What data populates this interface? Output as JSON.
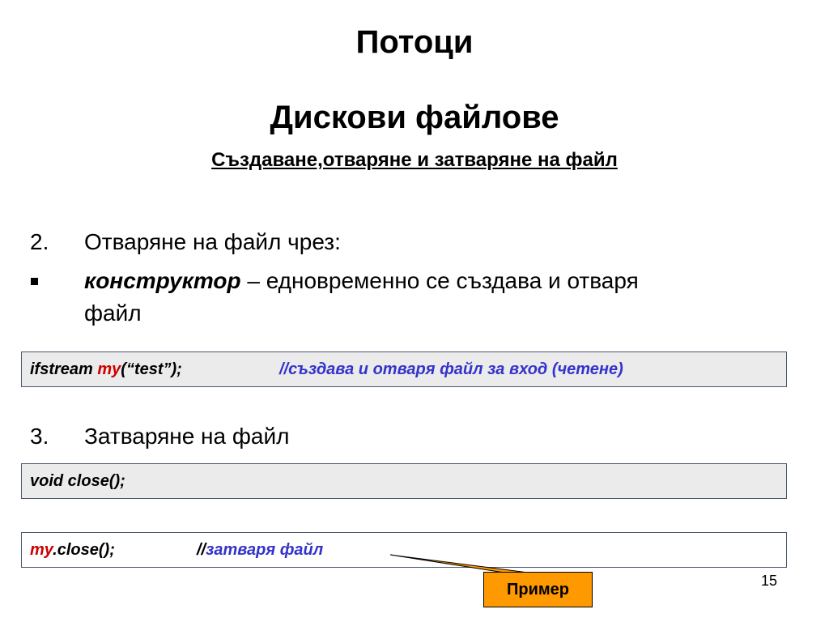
{
  "slide": {
    "title": "Потоци",
    "subtitle": "Дискови файлове",
    "section_heading": "Създаване,отваряне и затваряне на файл",
    "item2": {
      "number": "2.",
      "text": "Отваряне на файл чрез:"
    },
    "bullet": {
      "term": "конструктор",
      "text_line1": " – едновременно се създава и отваря",
      "text_line2": "файл"
    },
    "code1": {
      "part1": "ifstream ",
      "object": "my",
      "part2": "(“test”);",
      "comment": "//създава и отваря файл за вход (четене)"
    },
    "item3": {
      "number": "3.",
      "text": "Затваряне на файл"
    },
    "code2": {
      "text": "void close();"
    },
    "code3": {
      "object": "my",
      "part2": ".close();",
      "comment_slashes": "//",
      "comment_text": "затваря файл"
    },
    "example_button": "Пример",
    "page_number": "15"
  },
  "colors": {
    "code_background": "#ebebeb",
    "code_border": "#4d5a6e",
    "keyword_red": "#cc0000",
    "comment_blue": "#3333cc",
    "callout_fill": "#ff9900"
  }
}
